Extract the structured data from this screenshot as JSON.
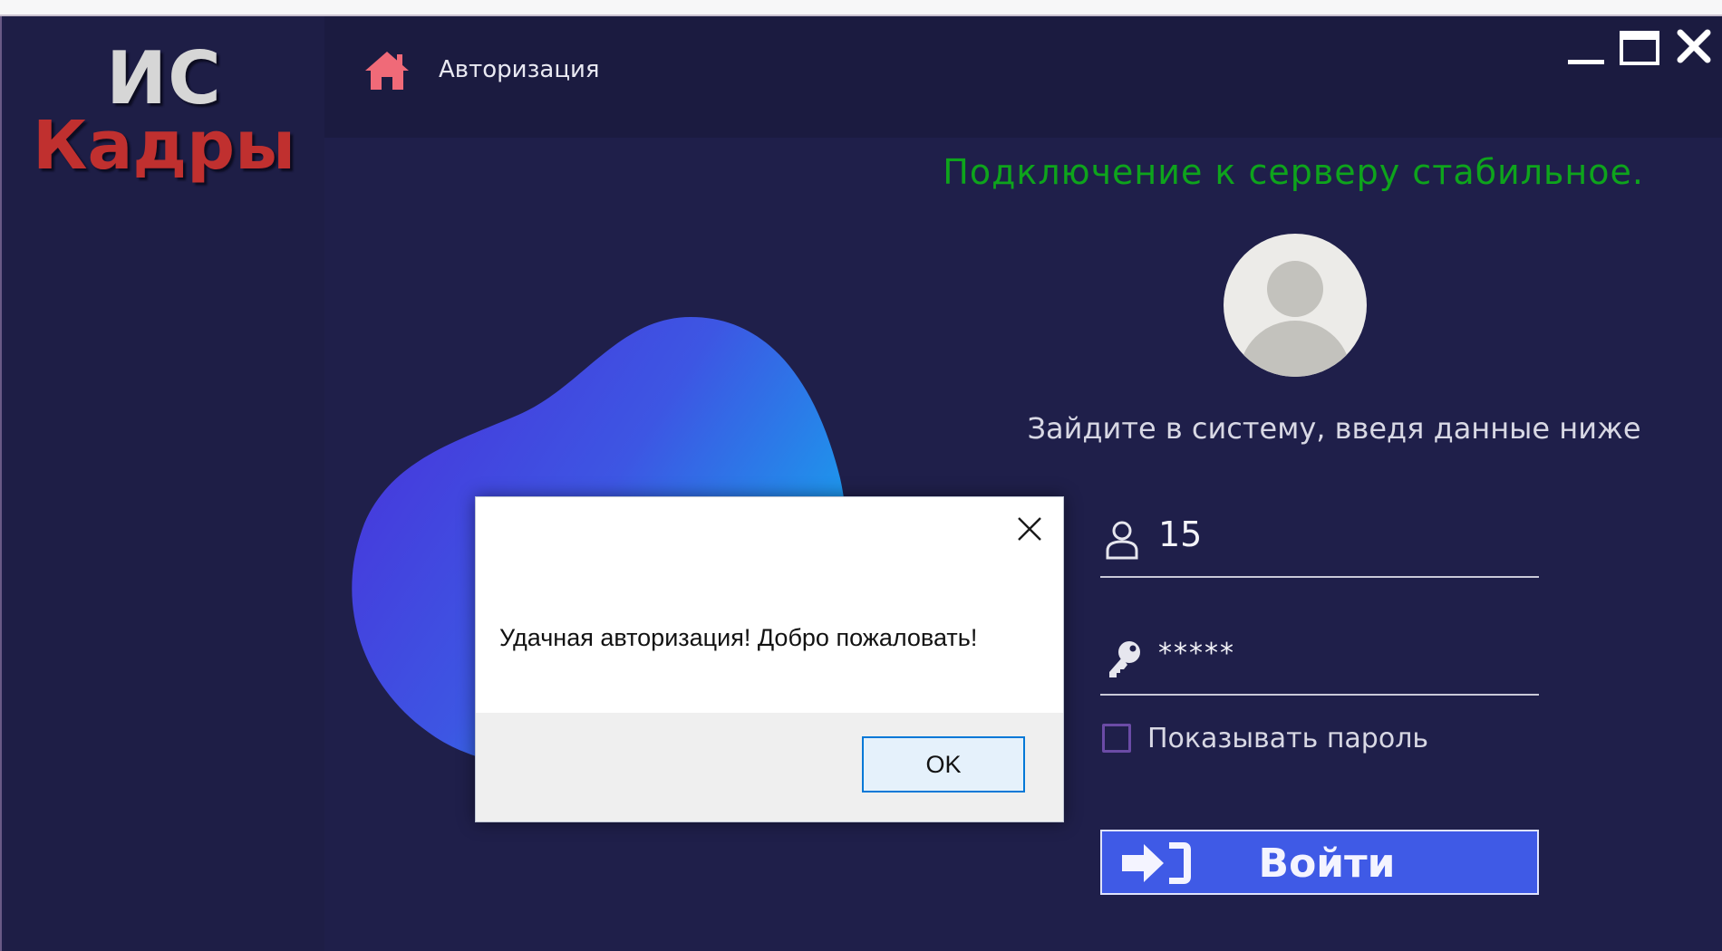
{
  "app": {
    "logo_top": "ИС",
    "logo_bottom": "Кадры"
  },
  "header": {
    "title": "Авторизация",
    "icon": "home-icon"
  },
  "window_controls": {
    "minimize_icon": "minimize-icon",
    "maximize_icon": "maximize-icon",
    "close_icon": "close-icon"
  },
  "status": {
    "text": "Подключение к серверу стабильное.",
    "color": "#0ea41c"
  },
  "login_form": {
    "hint": "Зайдите в систему, введя данные ниже",
    "login_value": "15",
    "password_value": "*****",
    "show_password_label": "Показывать пароль",
    "submit_label": "Войти"
  },
  "dialog": {
    "message": "Удачная авторизация! Добро пожаловать!",
    "ok_label": "OK"
  },
  "colors": {
    "background": "#1f1f4a",
    "accent": "#3f5ae6",
    "logo_red": "#c0302f",
    "home_icon": "#f06a78"
  }
}
